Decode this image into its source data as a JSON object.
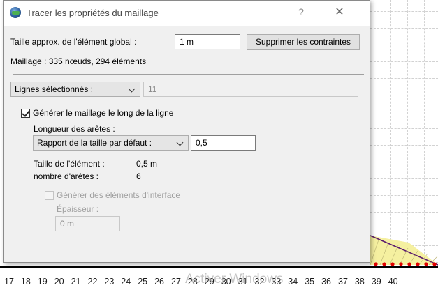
{
  "background": {
    "axis_ticks": [
      "17",
      "18",
      "19",
      "20",
      "21",
      "22",
      "23",
      "24",
      "25",
      "26",
      "27",
      "28",
      "29",
      "30",
      "31",
      "32",
      "33",
      "34",
      "35",
      "36",
      "37",
      "38",
      "39",
      "40"
    ],
    "watermark": "Activer Windows",
    "colors": {
      "mesh_fill": "#f5f0a0",
      "mesh_node": "#e00000",
      "mesh_line": "#5a1a6e"
    }
  },
  "dialog": {
    "title": "Tracer les propriétés du maillage",
    "help_glyph": "?",
    "close_glyph": "✕",
    "global_size": {
      "label": "Taille approx. de l'élément global :",
      "value": "1 m",
      "button": "Supprimer les contraintes"
    },
    "mesh_info": "Maillage : 335 nœuds, 294 éléments",
    "selection": {
      "dropdown": "Lignes sélectionnés :",
      "count": "11"
    },
    "generate_along_line": {
      "label": "Générer le maillage le long de la ligne",
      "checked": true
    },
    "edge_length": {
      "label": "Longueur des arêtes :",
      "mode": "Rapport de la taille par défaut :",
      "ratio": "0,5"
    },
    "element_size": {
      "label": "Taille de l'élément :",
      "value": "0,5 m"
    },
    "edge_count": {
      "label": "nombre d'arêtes :",
      "value": "6"
    },
    "interface": {
      "label": "Générer des éléments d'interface",
      "checked": false,
      "thickness_label": "Épaisseur :",
      "thickness_value": "0 m"
    }
  }
}
